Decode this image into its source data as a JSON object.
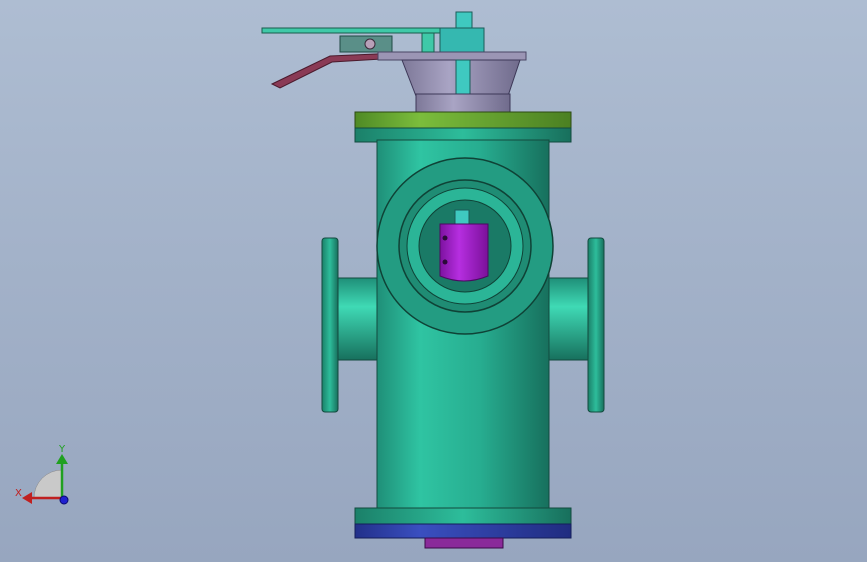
{
  "viewport": {
    "background_top": "#aebdd2",
    "background_bottom": "#97a6bf"
  },
  "model": {
    "body_color": "#2bb597",
    "flange_top_color": "#6aa533",
    "flange_bottom_color": "#2e3fa0",
    "inner_part_color": "#a020c8",
    "handle_color": "#8a3a55",
    "bonnet_color": "#9590b0"
  },
  "triad": {
    "x_label": "X",
    "y_label": "Y",
    "x_color": "#c02020",
    "y_color": "#20a020",
    "z_color": "#2020d0"
  }
}
